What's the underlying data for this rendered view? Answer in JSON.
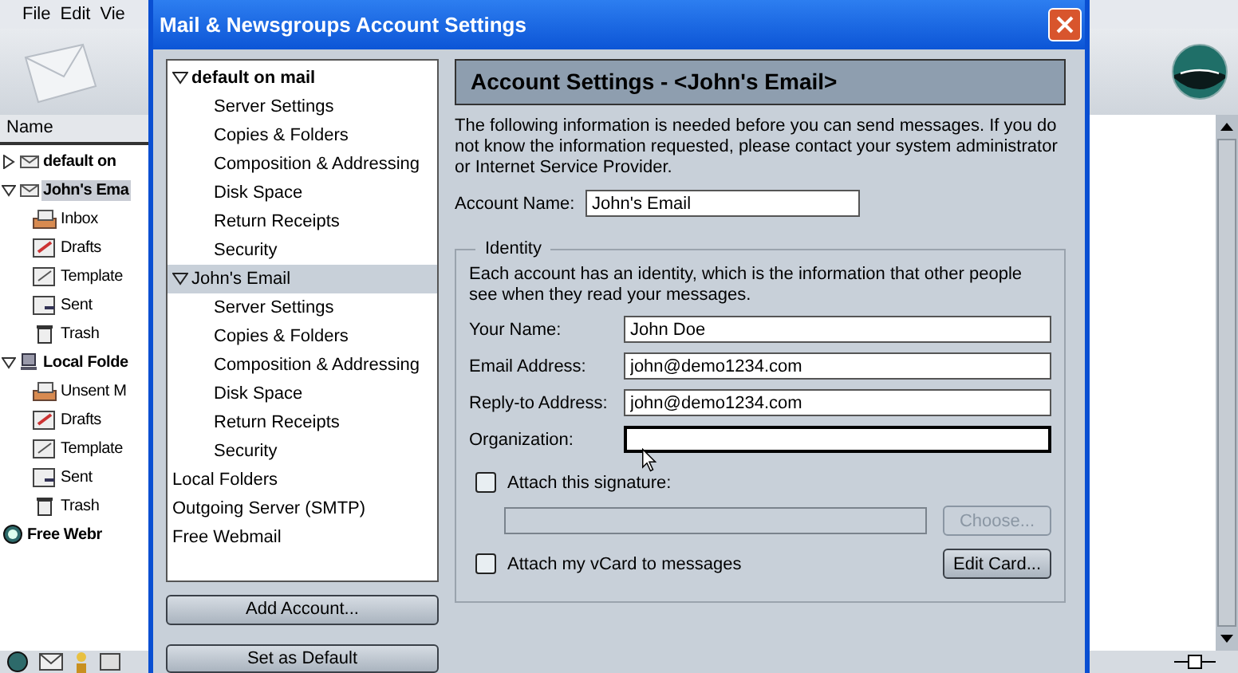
{
  "app": {
    "menu": [
      "File",
      "Edit",
      "Vie"
    ],
    "column": "Name",
    "folders": [
      {
        "label": "default on",
        "kind": "account",
        "expanded": false,
        "selected": false
      },
      {
        "label": "John's Ema",
        "kind": "account",
        "expanded": true,
        "selected": true,
        "children": [
          {
            "label": "Inbox",
            "kind": "inbox",
            "selected": false
          },
          {
            "label": "Drafts",
            "kind": "drafts",
            "selected": false
          },
          {
            "label": "Template",
            "kind": "templates",
            "selected": false
          },
          {
            "label": "Sent",
            "kind": "sent",
            "selected": false
          },
          {
            "label": "Trash",
            "kind": "trash",
            "selected": false
          }
        ]
      },
      {
        "label": "Local Folde",
        "kind": "local",
        "expanded": true,
        "selected": false,
        "children": [
          {
            "label": "Unsent M",
            "kind": "unsent",
            "selected": false
          },
          {
            "label": "Drafts",
            "kind": "drafts",
            "selected": false
          },
          {
            "label": "Template",
            "kind": "templates",
            "selected": false
          },
          {
            "label": "Sent",
            "kind": "sent",
            "selected": false
          },
          {
            "label": "Trash",
            "kind": "trash",
            "selected": false
          }
        ]
      },
      {
        "label": "Free Webr",
        "kind": "webmail",
        "selected": false
      }
    ]
  },
  "dialog": {
    "title": "Mail & Newsgroups Account Settings",
    "tree": [
      {
        "label": "default on mail",
        "default": true,
        "expanded": true,
        "selected": false,
        "children": [
          {
            "label": "Server Settings",
            "selected": false
          },
          {
            "label": "Copies & Folders",
            "selected": false
          },
          {
            "label": "Composition & Addressing",
            "selected": false
          },
          {
            "label": "Disk Space",
            "selected": false
          },
          {
            "label": "Return Receipts",
            "selected": false
          },
          {
            "label": "Security",
            "selected": false
          }
        ]
      },
      {
        "label": "John's Email",
        "default": false,
        "expanded": true,
        "selected": true,
        "children": [
          {
            "label": "Server Settings",
            "selected": false
          },
          {
            "label": "Copies & Folders",
            "selected": false
          },
          {
            "label": "Composition & Addressing",
            "selected": false
          },
          {
            "label": "Disk Space",
            "selected": false
          },
          {
            "label": "Return Receipts",
            "selected": false
          },
          {
            "label": "Security",
            "selected": false
          }
        ]
      },
      {
        "label": "Local Folders",
        "default": false,
        "selected": false
      },
      {
        "label": "Outgoing Server (SMTP)",
        "default": false,
        "selected": false
      },
      {
        "label": "Free Webmail",
        "default": false,
        "selected": false
      }
    ],
    "buttons": [
      "Add Account...",
      "Set as Default"
    ],
    "header": "Account Settings - <John's Email>",
    "intro": "The following information is needed before you can send messages. If you do not know the information requested, please contact your system administrator or Internet Service Provider.",
    "account_name": {
      "label": "Account Name:",
      "value": "John's Email"
    },
    "identity": {
      "legend": "Identity",
      "intro": "Each account has an identity, which is the information that other people see when they read your messages.",
      "fields": [
        {
          "label": "Your Name:",
          "value": "John Doe",
          "focused": false
        },
        {
          "label": "Email Address:",
          "value": "john@demo1234.com",
          "focused": false
        },
        {
          "label": "Reply-to Address:",
          "value": "john@demo1234.com",
          "focused": false
        },
        {
          "label": "Organization:",
          "focused": true
        }
      ],
      "signature": {
        "label": "Attach this signature:",
        "checked": false,
        "button": "Choose...",
        "disabled": true
      },
      "vcard": {
        "label": "Attach my vCard to messages",
        "checked": false,
        "button": "Edit Card...",
        "disabled": false
      }
    }
  }
}
